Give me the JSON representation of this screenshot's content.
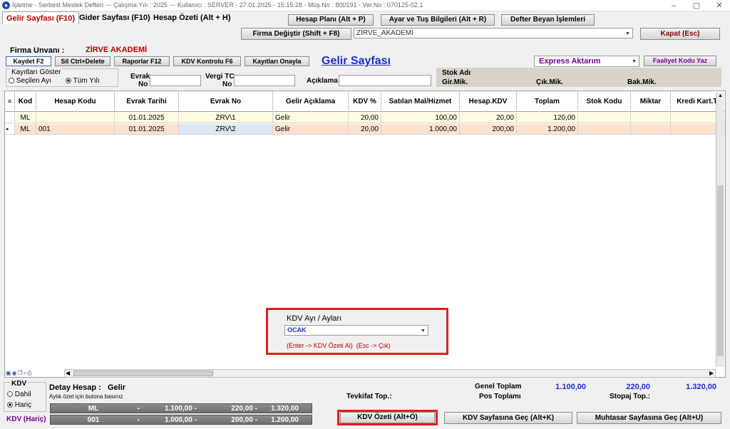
{
  "window": {
    "title": "İşletme - Serbest Meslek Defteri  ---  Çalışma Yılı : 2025  ---  Kullanıcı : SERVER - 27.01.2025 - 15:15:28 - Müş.No : 800191 - Ver.No : 070125-02.1",
    "controls": [
      "–",
      "▢",
      "✕"
    ]
  },
  "tabs": [
    "Gelir Sayfası (F10)",
    "Gider Sayfası (F10)",
    "Hesap Özeti (Alt + H)"
  ],
  "top_buttons": {
    "hesap_plani": "Hesap Planı (Alt + P)",
    "ayar": "Ayar ve Tuş Bilgileri (Alt + R)",
    "defter_beyan": "Defter Beyan İşlemleri",
    "firma_degistir": "Firma Değiştir (Shift + F8)",
    "kapat": "Kapat (Esc)"
  },
  "firma_combo": "ZİRVE_AKADEMİ",
  "firma": {
    "label": "Firma Unvanı :",
    "name": "ZİRVE AKADEMİ"
  },
  "toolbar": {
    "kaydet": "Kaydet F2",
    "sil": "Sil Ctrl+Delete",
    "raporlar": "Raporlar F12",
    "kdv_kontrol": "KDV Kontrolu F6",
    "kayitlari_onayla": "Kayıtları Onayla",
    "page_title": "Gelir Sayfası",
    "express_combo": "Express Aktarım",
    "faaliyet": "Faaliyet Kodu Yaz"
  },
  "filters": {
    "kayitlari_goster": "Kayıtları Göster",
    "secilen_ay": "Seçilen Ayı",
    "tum_yili": "Tüm Yılı",
    "evrak_no_1": "Evrak",
    "evrak_no_2": "No",
    "vergi_tc_1": "Vergi TC",
    "vergi_tc_2": "No",
    "aciklama": "Açıklama",
    "stok_adi": "Stok Adı",
    "gir_mik": "Gir.Mik.",
    "cik_mik": "Çık.Mik.",
    "bak_mik": "Bak.Mik."
  },
  "grid": {
    "columns": [
      "Kod",
      "Hesap Kodu",
      "Evrak Tarihi",
      "Evrak No",
      "Gelir Açıklama",
      "KDV %",
      "Satılan Mal/Hizmet",
      "Hesap.KDV",
      "Toplam",
      "Stok Kodu",
      "Miktar",
      "Kredi Kart.Tu"
    ],
    "rows": [
      [
        "ML",
        "",
        "01.01.2025",
        "ZRV\\1",
        "Gelir",
        "20,00",
        "100,00",
        "20,00",
        "120,00",
        "",
        "",
        ""
      ],
      [
        "ML",
        "001",
        "01.01.2025",
        "ZRV\\2",
        "Gelir",
        "20,00",
        "1.000,00",
        "200,00",
        "1.200,00",
        "",
        "",
        ""
      ]
    ],
    "row_indicator": "▸"
  },
  "kdv_popup": {
    "title": "KDV Ayı / Ayları",
    "selected": "OCAK",
    "hint_enter": "(Enter -> KDV Özeti Al)",
    "hint_esc": "(Esc -> Çık)"
  },
  "bottom": {
    "kdv_label": "KDV",
    "dahil": "Dahil",
    "haric": "Hariç",
    "kdv_haric": "KDV (Hariç)",
    "detay_hesap_label": "Detay Hesap :",
    "detay_hesap_value": "Gelir",
    "aylik_ozet_hint": "Aylık özet için butona basınız",
    "tevkifat": "Tevkifat  Top.:",
    "genel_toplam": "Genel Toplam",
    "pos_toplami": "Pos Toplamı",
    "stopaj": "Stopaj  Top.:",
    "genel_toplam_values": [
      "1.100,00",
      "220,00",
      "1.320,00"
    ],
    "summary_rows": [
      [
        "ML",
        "-",
        "1.100,00 -",
        "220,00 -",
        "1.320,00"
      ],
      [
        "001",
        "-",
        "1.000,00 -",
        "200,00 -",
        "1.200,00"
      ]
    ],
    "kdv_ozeti": "KDV Özeti (Alt+Ö)",
    "kdv_sayfasina_gec": "KDV Sayfasına Geç (Alt+K)",
    "muhtasar_gec": "Muhtasar Sayfasına Geç (Alt+U)"
  },
  "colors": {
    "accent_red": "#c00000",
    "title_blue": "#1a2fd6",
    "express_purple": "#7a0099",
    "highlight_box": "#e0201e",
    "row_yellow": "#fffbe0",
    "row_orange": "#fde2d0"
  }
}
